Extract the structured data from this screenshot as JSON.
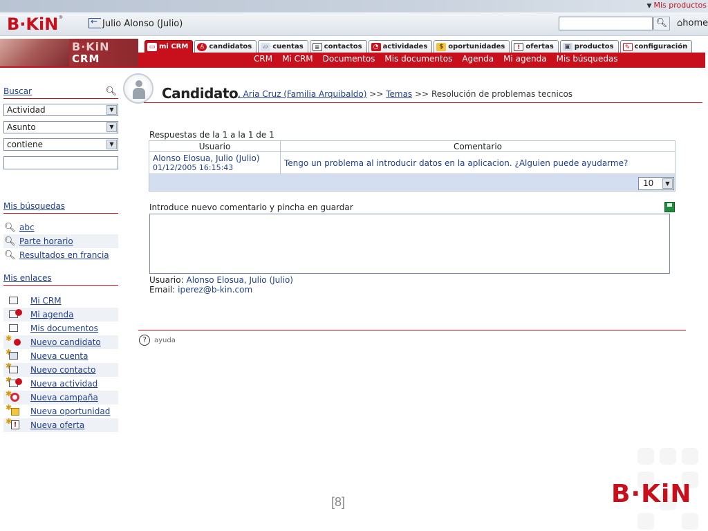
{
  "top": {
    "products_label": "Mis productos"
  },
  "header": {
    "logo": "B·KiN",
    "user_name": "Julio Alonso (Julio)",
    "search_placeholder": "",
    "home_label": "home"
  },
  "banner": {
    "brand": "B·KiN",
    "product": "CRM"
  },
  "tabs": [
    {
      "label": "mi CRM",
      "icon": "monitor-icon",
      "active": true
    },
    {
      "label": "candidatos",
      "icon": "candidate-icon"
    },
    {
      "label": "cuentas",
      "icon": "folder-icon"
    },
    {
      "label": "contactos",
      "icon": "contact-card-icon"
    },
    {
      "label": "actividades",
      "icon": "activity-icon"
    },
    {
      "label": "oportunidades",
      "icon": "opportunity-icon"
    },
    {
      "label": "ofertas",
      "icon": "offer-icon"
    },
    {
      "label": "productos",
      "icon": "product-box-icon"
    },
    {
      "label": "configuración",
      "icon": "config-icon"
    }
  ],
  "subnav": [
    "CRM",
    "Mi CRM",
    "Documentos",
    "Mis documentos",
    "Agenda",
    "Mi agenda",
    "Mis búsquedas"
  ],
  "sidebar": {
    "search_title": "Buscar",
    "selects": [
      "Actividad",
      "Asunto",
      "contiene"
    ],
    "search_value": "",
    "saved_title": "Mis búsquedas",
    "saved": [
      "abc",
      "Parte horario",
      "Resultados en francia"
    ],
    "links_title": "Mis enlaces",
    "links": [
      {
        "label": "Mi CRM",
        "icon": "monitor-icon"
      },
      {
        "label": "Mi agenda",
        "icon": "agenda-icon"
      },
      {
        "label": "Mis documentos",
        "icon": "documents-icon"
      },
      {
        "label": "Nuevo candidato",
        "icon": "new-candidate-icon"
      },
      {
        "label": "Nueva cuenta",
        "icon": "new-account-icon"
      },
      {
        "label": "Nuevo contacto",
        "icon": "new-contact-icon"
      },
      {
        "label": "Nueva actividad",
        "icon": "new-activity-icon"
      },
      {
        "label": "Nueva campaña",
        "icon": "new-campaign-icon"
      },
      {
        "label": "Nueva oportunidad",
        "icon": "new-opportunity-icon"
      },
      {
        "label": "Nueva oferta",
        "icon": "new-offer-icon"
      }
    ]
  },
  "main": {
    "title": "Candidato",
    "breadcrumb": {
      "account": ", Aria Cruz (Familia Arquibaldo)",
      "sep1": ">>",
      "topics": "Temas",
      "sep2": ">>",
      "current": "Resolución de problemas tecnicos"
    },
    "responses_count": "Respuestas de la 1 a la 1 de 1",
    "table": {
      "headers": [
        "Usuario",
        "Comentario"
      ],
      "rows": [
        {
          "user": "Alonso Elosua, Julio (Julio)",
          "date": "01/12/2005 16:15:43",
          "comment": "Tengo un problema al introducir datos en la aplicacion. ¿Alguien puede ayudarme?"
        }
      ],
      "page_size": "10"
    },
    "new_comment_label": "Introduce nuevo comentario y pincha en guardar",
    "comment_value": "",
    "user_label": "Usuario:",
    "user_value": "Alonso Elosua, Julio (Julio)",
    "email_label": "Email:",
    "email_value": "iperez@b-kin.com",
    "help_label": "ayuda"
  },
  "footer": {
    "page_number": "[8]",
    "brand": "B·KiN"
  },
  "colors": {
    "accent_red": "#c8101c",
    "link_blue": "#1f3f8f",
    "table_footer": "#d3def1"
  }
}
